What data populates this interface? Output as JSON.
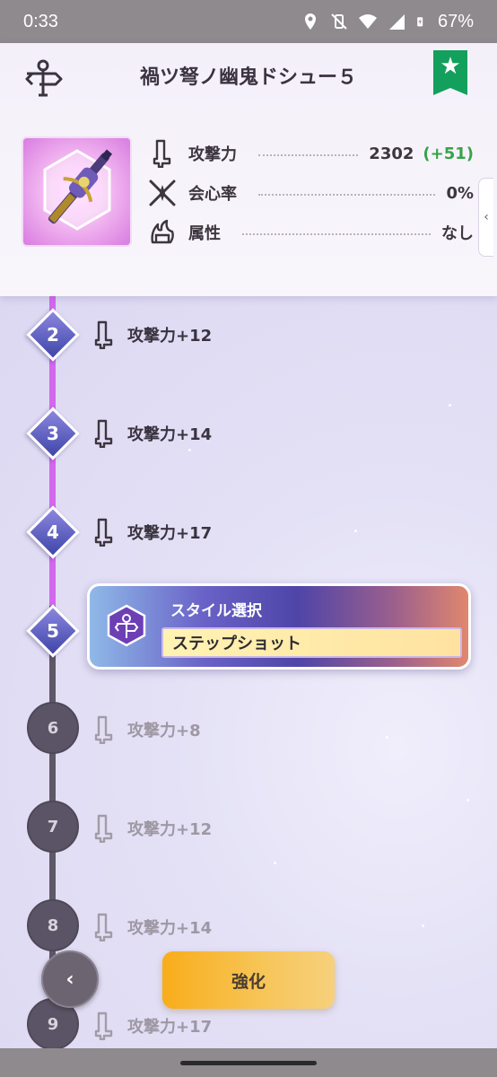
{
  "status_bar": {
    "time": "0:33",
    "battery": "67%",
    "icons": [
      "location-icon",
      "vibrate-off-icon",
      "wifi-icon",
      "signal-icon",
      "battery-charging-icon"
    ]
  },
  "header": {
    "title": "禍ツ弩ノ幽鬼ドシュー５",
    "favorite_icon": "star-icon",
    "guide_icon": "signpost-icon",
    "stats": [
      {
        "icon": "attack-icon",
        "label": "攻撃力",
        "value": "2302",
        "bonus": "(+51)"
      },
      {
        "icon": "critical-icon",
        "label": "会心率",
        "value": "0%",
        "bonus": ""
      },
      {
        "icon": "element-icon",
        "label": "属性",
        "value": "なし",
        "bonus": ""
      }
    ],
    "side_tab": "‹"
  },
  "tree": {
    "nodes": [
      {
        "level": "2",
        "reward": "攻撃力+12",
        "state": "unlocked"
      },
      {
        "level": "3",
        "reward": "攻撃力+14",
        "state": "unlocked"
      },
      {
        "level": "4",
        "reward": "攻撃力+17",
        "state": "unlocked"
      },
      {
        "level": "5",
        "reward": "",
        "state": "current"
      },
      {
        "level": "6",
        "reward": "攻撃力+8",
        "state": "locked"
      },
      {
        "level": "7",
        "reward": "攻撃力+12",
        "state": "locked"
      },
      {
        "level": "8",
        "reward": "攻撃力+14",
        "state": "locked"
      },
      {
        "level": "9",
        "reward": "攻撃力+17",
        "state": "locked"
      }
    ],
    "style_card": {
      "title": "スタイル選択",
      "selected": "ステップショット"
    }
  },
  "footer": {
    "back_label": "‹",
    "enhance_label": "強化"
  },
  "colors": {
    "active_line": "#d268ec",
    "locked_line": "#5e5868",
    "favorite": "#13a05c",
    "bonus": "#37a34a",
    "enhance": "#f8ad1a"
  }
}
